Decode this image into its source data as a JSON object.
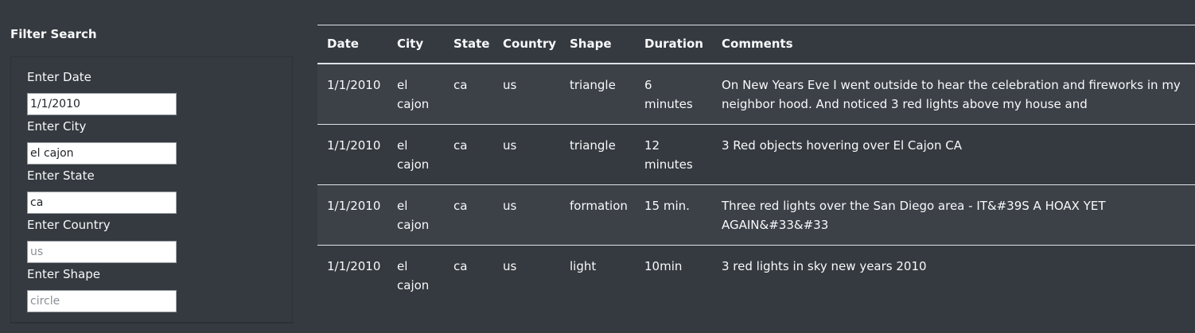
{
  "filter": {
    "title": "Filter Search",
    "fields": [
      {
        "label": "Enter Date",
        "value": "1/1/2010",
        "placeholder": ""
      },
      {
        "label": "Enter City",
        "value": "el cajon",
        "placeholder": ""
      },
      {
        "label": "Enter State",
        "value": "ca",
        "placeholder": ""
      },
      {
        "label": "Enter Country",
        "value": "",
        "placeholder": "us"
      },
      {
        "label": "Enter Shape",
        "value": "",
        "placeholder": "circle"
      }
    ]
  },
  "table": {
    "headers": [
      "Date",
      "City",
      "State",
      "Country",
      "Shape",
      "Duration",
      "Comments"
    ],
    "rows": [
      [
        "1/1/2010",
        "el cajon",
        "ca",
        "us",
        "triangle",
        "6 minutes",
        "On New Years Eve I went outside to hear the celebration and fireworks in my neighbor hood. And noticed 3 red lights above my house and"
      ],
      [
        "1/1/2010",
        "el cajon",
        "ca",
        "us",
        "triangle",
        "12 minutes",
        "3 Red objects hovering over El Cajon CA"
      ],
      [
        "1/1/2010",
        "el cajon",
        "ca",
        "us",
        "formation",
        "15 min.",
        "Three red lights over the San Diego area - IT&#39S A HOAX YET AGAIN&#33&#33"
      ],
      [
        "1/1/2010",
        "el cajon",
        "ca",
        "us",
        "light",
        "10min",
        "3 red lights in sky new years 2010"
      ]
    ]
  }
}
